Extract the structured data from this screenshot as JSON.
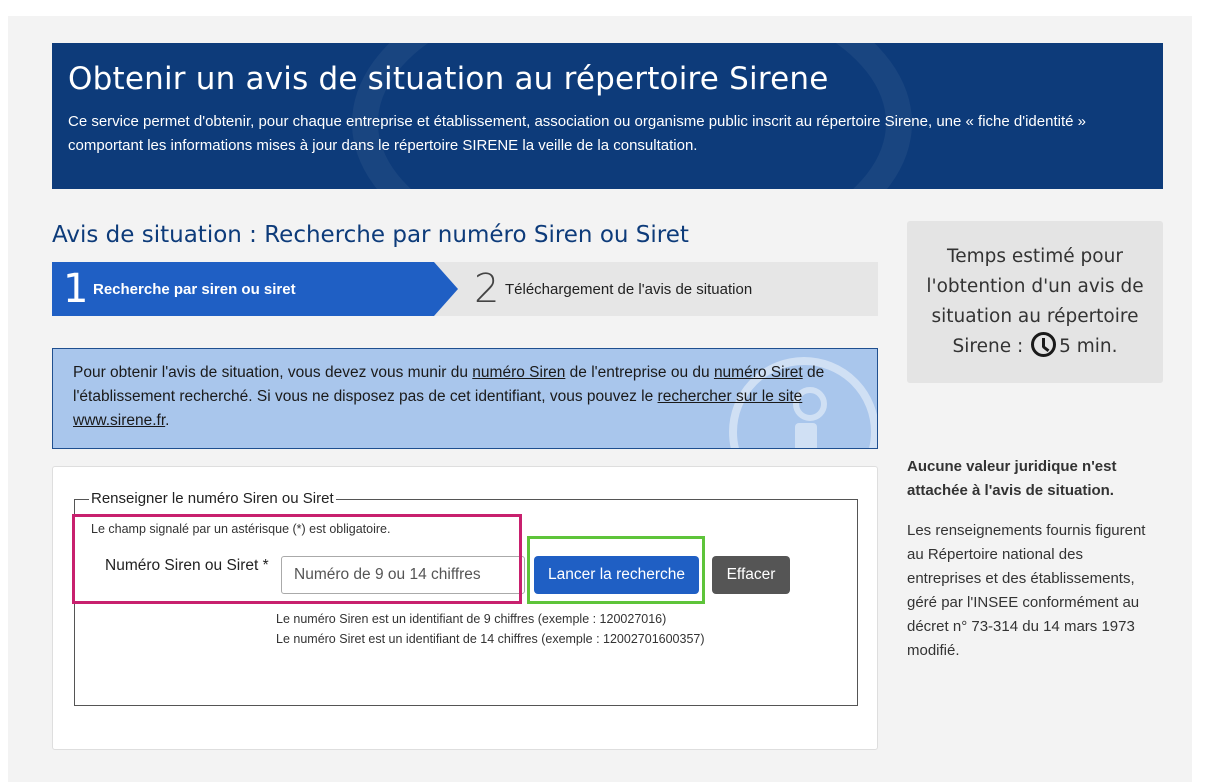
{
  "hero": {
    "title": "Obtenir un avis de situation au répertoire Sirene",
    "description": "Ce service permet d'obtenir, pour chaque entreprise et établissement, association ou organisme public inscrit au répertoire Sirene, une « fiche d'identité » comportant les informations mises à jour dans le répertoire SIRENE la veille de la consultation."
  },
  "section": {
    "title": "Avis de situation : Recherche par numéro Siren ou Siret"
  },
  "steps": [
    {
      "number": "1",
      "label": "Recherche par siren ou siret"
    },
    {
      "number": "2",
      "label": "Téléchargement de l'avis de situation"
    }
  ],
  "info": {
    "part1": "Pour obtenir l'avis de situation, vous devez vous munir du ",
    "link_siren": "numéro Siren",
    "part2": " de l'entreprise ou du ",
    "link_siret": "numéro Siret",
    "part3": " de l'établissement recherché. Si vous ne disposez pas de cet identifiant, vous pouvez le ",
    "link_search": "rechercher sur le site www.sirene.fr",
    "part4": "."
  },
  "form": {
    "legend": "Renseigner le numéro Siren ou Siret",
    "required_note": "Le champ signalé par un astérisque (*) est obligatoire.",
    "field_label": "Numéro Siren ou Siret *",
    "input_placeholder": "Numéro de 9 ou 14 chiffres",
    "input_value": "",
    "search_button": "Lancer la recherche",
    "clear_button": "Effacer",
    "hint_siren": "Le numéro Siren est un identifiant de 9 chiffres (exemple : 120027016)",
    "hint_siret": "Le numéro Siret est un identifiant de 14 chiffres (exemple : 12002701600357)"
  },
  "sidebar": {
    "time_text": "Temps estimé pour l'obtention d'un avis de situation au répertoire Sirene :",
    "time_value": "5 min.",
    "clock_icon": "clock-icon",
    "legal_bold": "Aucune valeur juridique n'est attachée à l'avis de situation.",
    "legal_text": "Les renseignements fournis figurent au Répertoire national des entreprises et des établissements, géré par l'INSEE conformément au décret n° 73-314 du 14 mars 1973 modifié."
  },
  "colors": {
    "hero_bg": "#0d3b7a",
    "primary": "#1f5fc4",
    "info_bg": "#a9c6ec",
    "highlight_pink": "#c8206e",
    "highlight_green": "#5ec43a"
  }
}
